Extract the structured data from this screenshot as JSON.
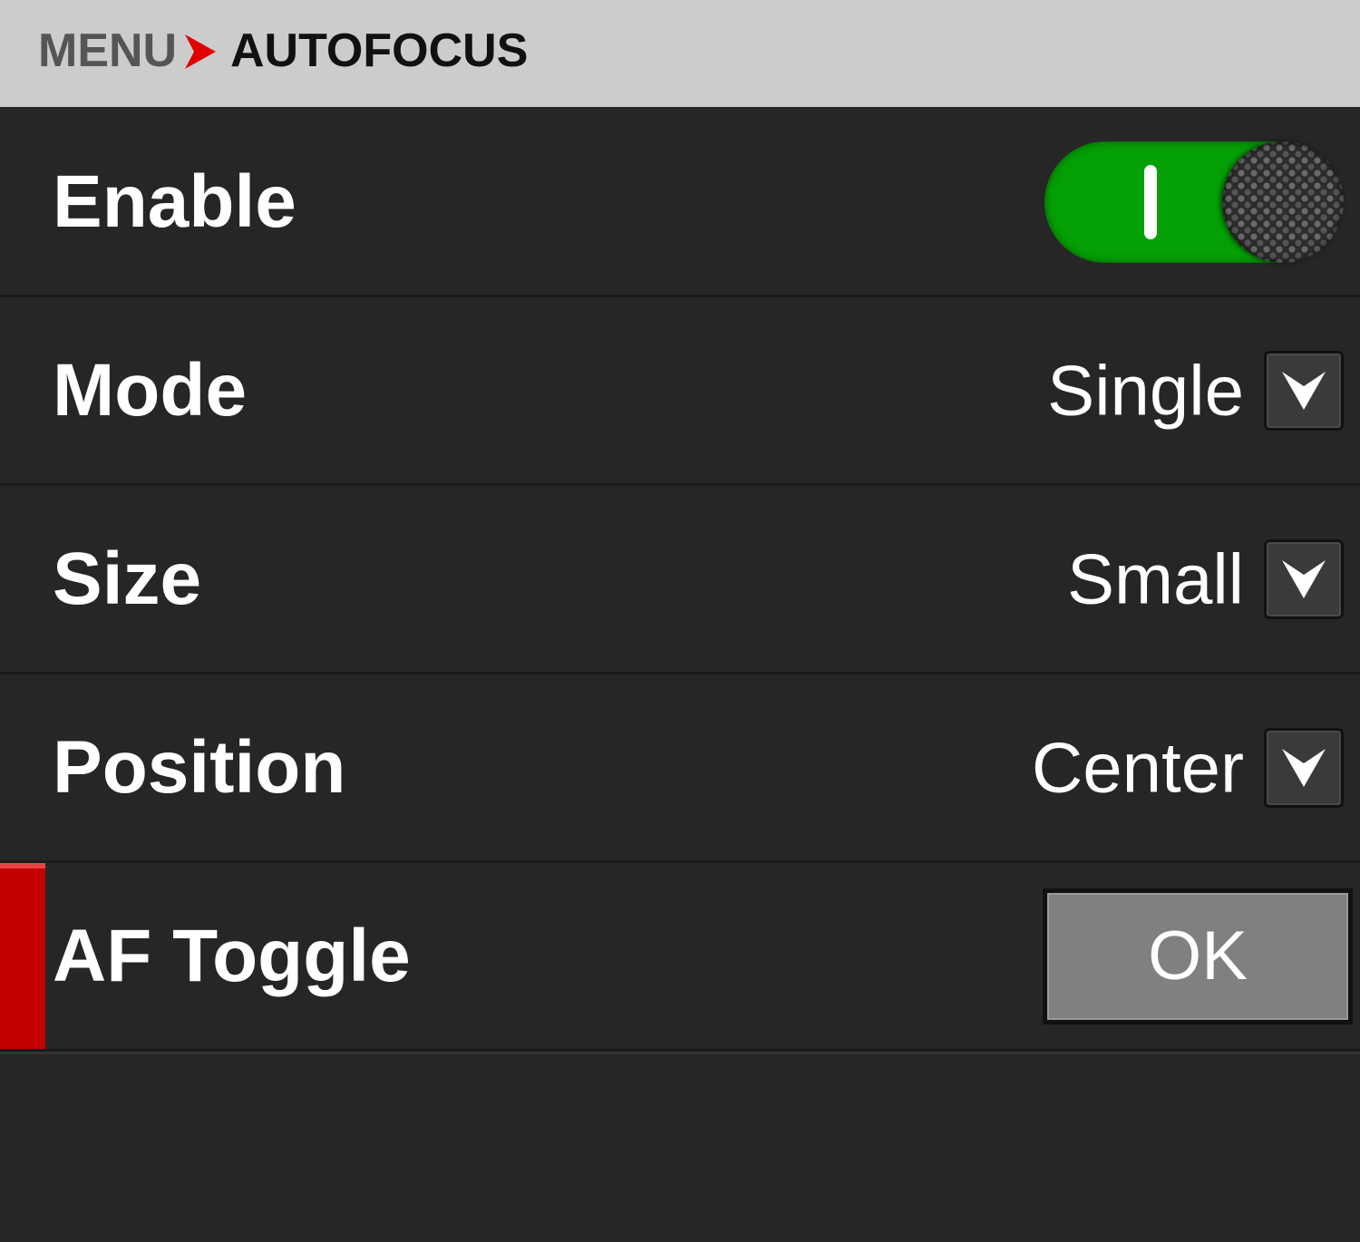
{
  "breadcrumb": {
    "root": "MENU",
    "current": "AUTOFOCUS"
  },
  "rows": [
    {
      "label": "Enable",
      "control": "toggle",
      "state": "on"
    },
    {
      "label": "Mode",
      "control": "dropdown",
      "value": "Single"
    },
    {
      "label": "Size",
      "control": "dropdown",
      "value": "Small"
    },
    {
      "label": "Position",
      "control": "dropdown",
      "value": "Center"
    },
    {
      "label": "AF Toggle",
      "control": "button",
      "button_label": "OK",
      "selected": true
    }
  ],
  "colors": {
    "header_bg": "#cccccc",
    "background": "#262626",
    "accent": "#c40000",
    "toggle_on": "#05a005",
    "button_bg": "#808080"
  },
  "icons": {
    "breadcrumb_separator": "chevron-right-icon",
    "dropdown": "chevron-down-icon"
  }
}
